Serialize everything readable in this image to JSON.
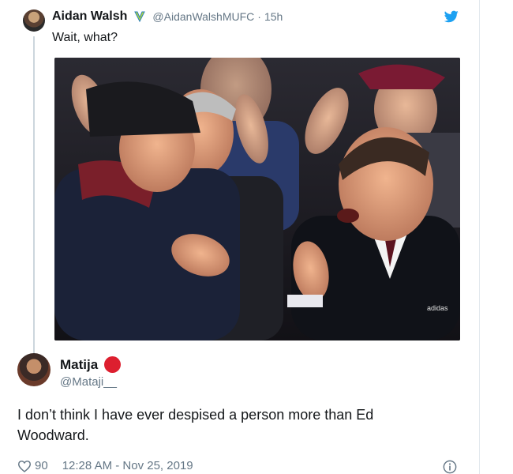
{
  "quoted_tweet": {
    "name": "Aidan Walsh",
    "handle": "@AidanWalshMUFC",
    "time": "15h",
    "text": "Wait, what?",
    "photo_text": "adidas"
  },
  "reply_tweet": {
    "name": "Matija",
    "handle": "@Mataji__",
    "text": "I don’t think I have ever despised a person more than Ed Woodward.",
    "likes": "90",
    "timestamp": "12:28 AM - Nov 25, 2019"
  },
  "icons": {
    "badge": "verified-style-badge",
    "brand": "twitter-bird-icon",
    "like": "heart-icon",
    "info": "info-icon"
  },
  "colors": {
    "twitter_blue": "#1da1f2",
    "red_dot": "#dd1f2f",
    "secondary_text": "#657786"
  }
}
